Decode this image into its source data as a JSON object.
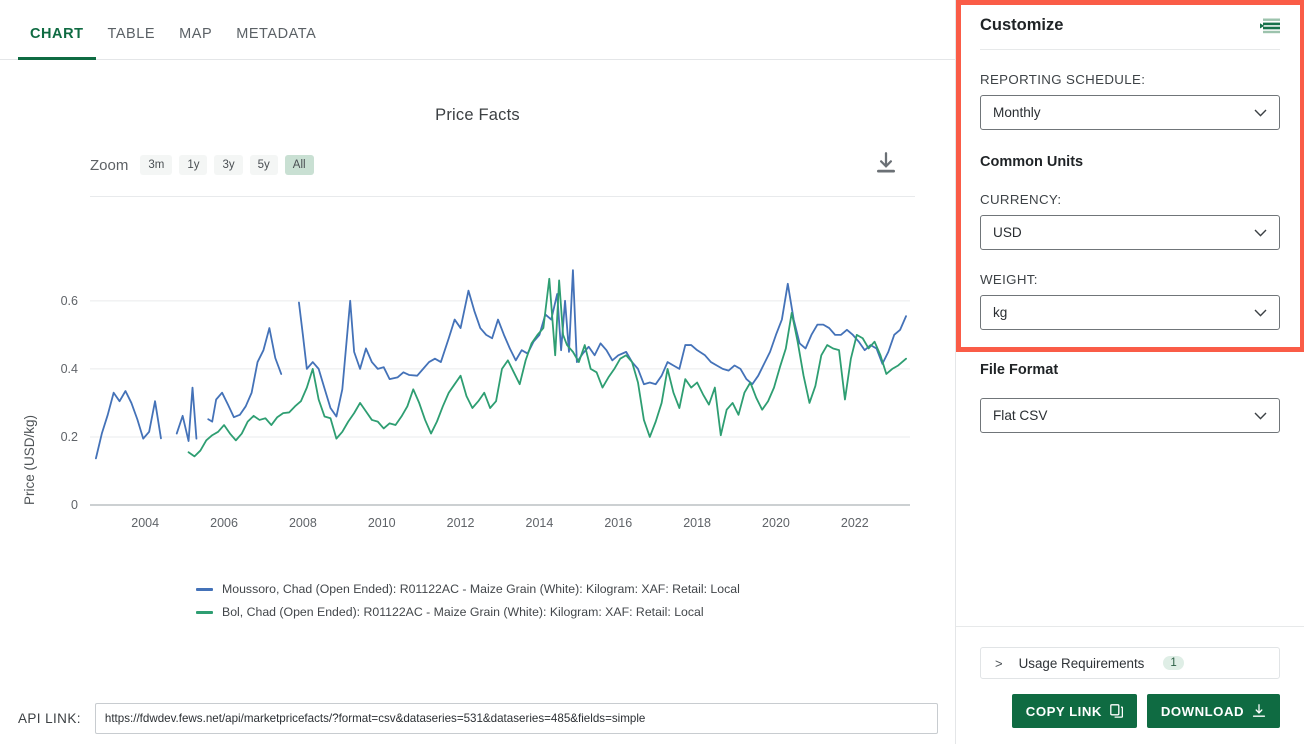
{
  "tabs": [
    {
      "label": "CHART",
      "active": true
    },
    {
      "label": "TABLE",
      "active": false
    },
    {
      "label": "MAP",
      "active": false
    },
    {
      "label": "METADATA",
      "active": false
    }
  ],
  "chart_header": {
    "title": "Price Facts",
    "zoom_label": "Zoom",
    "zoom_options": [
      "3m",
      "1y",
      "3y",
      "5y",
      "All"
    ],
    "zoom_selected": "All",
    "download_icon": "download-icon"
  },
  "chart_data": {
    "type": "line",
    "title": "Price Facts",
    "xlabel": "",
    "ylabel": "Price (USD/kg)",
    "xticks": [
      2004,
      2006,
      2008,
      2010,
      2012,
      2014,
      2016,
      2018,
      2020,
      2022
    ],
    "yticks": [
      0,
      0.2,
      0.4,
      0.6
    ],
    "ylim": [
      0,
      0.72
    ],
    "xlim": [
      2002.6,
      2023.4
    ],
    "grid": true,
    "legend_position": "bottom-left",
    "series": [
      {
        "name": "Moussoro, Chad (Open Ended): R01122AC - Maize Grain (White): Kilogram: XAF: Retail: Local",
        "color": "#4472b8",
        "points": [
          [
            2002.75,
            0.137
          ],
          [
            2002.9,
            0.21
          ],
          [
            2003.05,
            0.265
          ],
          [
            2003.2,
            0.33
          ],
          [
            2003.35,
            0.305
          ],
          [
            2003.5,
            0.335
          ],
          [
            2003.65,
            0.3
          ],
          [
            2003.8,
            0.252
          ],
          [
            2003.95,
            0.195
          ],
          [
            2004.1,
            0.215
          ],
          [
            2004.25,
            0.305
          ],
          [
            2004.4,
            0.196
          ],
          [
            2004.55,
            null
          ],
          [
            2004.8,
            0.21
          ],
          [
            2004.95,
            0.262
          ],
          [
            2005.1,
            0.188
          ],
          [
            2005.2,
            0.345
          ],
          [
            2005.3,
            0.195
          ],
          [
            2005.45,
            null
          ],
          [
            2005.6,
            0.252
          ],
          [
            2005.7,
            0.245
          ],
          [
            2005.8,
            0.31
          ],
          [
            2005.95,
            0.33
          ],
          [
            2006.1,
            0.295
          ],
          [
            2006.25,
            0.258
          ],
          [
            2006.4,
            0.265
          ],
          [
            2006.55,
            0.29
          ],
          [
            2006.7,
            0.33
          ],
          [
            2006.85,
            0.42
          ],
          [
            2007.0,
            0.455
          ],
          [
            2007.15,
            0.52
          ],
          [
            2007.3,
            0.432
          ],
          [
            2007.45,
            0.385
          ],
          [
            2007.6,
            null
          ],
          [
            2007.9,
            0.595
          ],
          [
            2008.0,
            0.5
          ],
          [
            2008.1,
            0.4
          ],
          [
            2008.25,
            0.42
          ],
          [
            2008.4,
            0.4
          ],
          [
            2008.55,
            0.342
          ],
          [
            2008.7,
            0.285
          ],
          [
            2008.85,
            0.26
          ],
          [
            2009.0,
            0.34
          ],
          [
            2009.2,
            0.6
          ],
          [
            2009.3,
            0.45
          ],
          [
            2009.45,
            0.4
          ],
          [
            2009.6,
            0.46
          ],
          [
            2009.75,
            0.42
          ],
          [
            2009.9,
            0.4
          ],
          [
            2010.05,
            0.405
          ],
          [
            2010.2,
            0.37
          ],
          [
            2010.4,
            0.375
          ],
          [
            2010.55,
            0.39
          ],
          [
            2010.7,
            0.382
          ],
          [
            2010.9,
            0.38
          ],
          [
            2011.05,
            0.4
          ],
          [
            2011.2,
            0.42
          ],
          [
            2011.35,
            0.43
          ],
          [
            2011.5,
            0.42
          ],
          [
            2011.7,
            0.49
          ],
          [
            2011.85,
            0.545
          ],
          [
            2012.0,
            0.52
          ],
          [
            2012.2,
            0.63
          ],
          [
            2012.35,
            0.57
          ],
          [
            2012.5,
            0.52
          ],
          [
            2012.65,
            0.5
          ],
          [
            2012.8,
            0.49
          ],
          [
            2012.95,
            0.545
          ],
          [
            2013.1,
            0.5
          ],
          [
            2013.25,
            0.46
          ],
          [
            2013.4,
            0.425
          ],
          [
            2013.55,
            0.455
          ],
          [
            2013.7,
            0.445
          ],
          [
            2013.85,
            0.48
          ],
          [
            2014.0,
            0.5
          ],
          [
            2014.15,
            0.56
          ],
          [
            2014.3,
            0.545
          ],
          [
            2014.45,
            0.62
          ],
          [
            2014.55,
            0.455
          ],
          [
            2014.65,
            0.6
          ],
          [
            2014.75,
            0.45
          ],
          [
            2014.85,
            0.69
          ],
          [
            2014.95,
            0.42
          ],
          [
            2015.1,
            0.445
          ],
          [
            2015.25,
            0.465
          ],
          [
            2015.4,
            0.44
          ],
          [
            2015.55,
            0.475
          ],
          [
            2015.7,
            0.455
          ],
          [
            2015.85,
            0.425
          ],
          [
            2016.0,
            0.44
          ],
          [
            2016.2,
            0.45
          ],
          [
            2016.35,
            0.42
          ],
          [
            2016.5,
            0.4
          ],
          [
            2016.65,
            0.355
          ],
          [
            2016.8,
            0.36
          ],
          [
            2016.95,
            0.355
          ],
          [
            2017.1,
            0.38
          ],
          [
            2017.25,
            0.42
          ],
          [
            2017.4,
            0.41
          ],
          [
            2017.55,
            0.4
          ],
          [
            2017.7,
            0.47
          ],
          [
            2017.85,
            0.47
          ],
          [
            2018.0,
            0.455
          ],
          [
            2018.2,
            0.44
          ],
          [
            2018.35,
            0.42
          ],
          [
            2018.5,
            0.41
          ],
          [
            2018.65,
            0.4
          ],
          [
            2018.8,
            0.395
          ],
          [
            2018.95,
            0.41
          ],
          [
            2019.1,
            0.4
          ],
          [
            2019.25,
            0.37
          ],
          [
            2019.4,
            0.355
          ],
          [
            2019.55,
            0.38
          ],
          [
            2019.7,
            0.415
          ],
          [
            2019.85,
            0.45
          ],
          [
            2020.0,
            0.5
          ],
          [
            2020.15,
            0.545
          ],
          [
            2020.3,
            0.65
          ],
          [
            2020.45,
            0.545
          ],
          [
            2020.6,
            0.475
          ],
          [
            2020.75,
            0.46
          ],
          [
            2020.9,
            0.5
          ],
          [
            2021.05,
            0.53
          ],
          [
            2021.2,
            0.53
          ],
          [
            2021.35,
            0.52
          ],
          [
            2021.5,
            0.5
          ],
          [
            2021.65,
            0.5
          ],
          [
            2021.8,
            0.515
          ],
          [
            2021.95,
            0.5
          ],
          [
            2022.1,
            0.48
          ],
          [
            2022.25,
            0.455
          ],
          [
            2022.4,
            0.47
          ],
          [
            2022.55,
            0.46
          ],
          [
            2022.7,
            0.415
          ],
          [
            2022.85,
            0.45
          ],
          [
            2023.0,
            0.5
          ],
          [
            2023.15,
            0.515
          ],
          [
            2023.3,
            0.555
          ]
        ]
      },
      {
        "name": "Bol, Chad (Open Ended): R01122AC - Maize Grain (White): Kilogram: XAF: Retail: Local",
        "color": "#2e9e72",
        "points": [
          [
            2005.1,
            0.155
          ],
          [
            2005.25,
            0.143
          ],
          [
            2005.4,
            0.16
          ],
          [
            2005.55,
            0.19
          ],
          [
            2005.7,
            0.205
          ],
          [
            2005.85,
            0.215
          ],
          [
            2006.0,
            0.235
          ],
          [
            2006.15,
            0.21
          ],
          [
            2006.3,
            0.19
          ],
          [
            2006.45,
            0.21
          ],
          [
            2006.6,
            0.245
          ],
          [
            2006.75,
            0.262
          ],
          [
            2006.9,
            0.25
          ],
          [
            2007.05,
            0.255
          ],
          [
            2007.2,
            0.235
          ],
          [
            2007.35,
            0.258
          ],
          [
            2007.5,
            0.27
          ],
          [
            2007.65,
            0.272
          ],
          [
            2007.8,
            0.29
          ],
          [
            2007.95,
            0.305
          ],
          [
            2008.1,
            0.345
          ],
          [
            2008.25,
            0.4
          ],
          [
            2008.4,
            0.31
          ],
          [
            2008.55,
            0.26
          ],
          [
            2008.7,
            0.255
          ],
          [
            2008.85,
            0.195
          ],
          [
            2009.0,
            0.215
          ],
          [
            2009.15,
            0.245
          ],
          [
            2009.3,
            0.27
          ],
          [
            2009.45,
            0.3
          ],
          [
            2009.6,
            0.275
          ],
          [
            2009.75,
            0.25
          ],
          [
            2009.9,
            0.245
          ],
          [
            2010.05,
            0.225
          ],
          [
            2010.2,
            0.24
          ],
          [
            2010.35,
            0.235
          ],
          [
            2010.5,
            0.26
          ],
          [
            2010.65,
            0.29
          ],
          [
            2010.8,
            0.34
          ],
          [
            2010.95,
            0.3
          ],
          [
            2011.1,
            0.25
          ],
          [
            2011.25,
            0.21
          ],
          [
            2011.4,
            0.245
          ],
          [
            2011.55,
            0.29
          ],
          [
            2011.7,
            0.33
          ],
          [
            2011.85,
            0.355
          ],
          [
            2012.0,
            0.38
          ],
          [
            2012.15,
            0.32
          ],
          [
            2012.3,
            0.285
          ],
          [
            2012.45,
            0.305
          ],
          [
            2012.6,
            0.33
          ],
          [
            2012.75,
            0.285
          ],
          [
            2012.9,
            0.305
          ],
          [
            2013.05,
            0.4
          ],
          [
            2013.2,
            0.425
          ],
          [
            2013.35,
            0.39
          ],
          [
            2013.5,
            0.355
          ],
          [
            2013.65,
            0.425
          ],
          [
            2013.8,
            0.475
          ],
          [
            2013.95,
            0.5
          ],
          [
            2014.1,
            0.52
          ],
          [
            2014.25,
            0.665
          ],
          [
            2014.4,
            0.44
          ],
          [
            2014.5,
            0.66
          ],
          [
            2014.6,
            0.5
          ],
          [
            2014.7,
            0.47
          ],
          [
            2014.85,
            0.45
          ],
          [
            2015.0,
            0.42
          ],
          [
            2015.15,
            0.47
          ],
          [
            2015.3,
            0.4
          ],
          [
            2015.45,
            0.39
          ],
          [
            2015.6,
            0.345
          ],
          [
            2015.75,
            0.375
          ],
          [
            2015.9,
            0.4
          ],
          [
            2016.05,
            0.43
          ],
          [
            2016.2,
            0.44
          ],
          [
            2016.35,
            0.42
          ],
          [
            2016.5,
            0.36
          ],
          [
            2016.65,
            0.25
          ],
          [
            2016.8,
            0.2
          ],
          [
            2016.95,
            0.245
          ],
          [
            2017.1,
            0.3
          ],
          [
            2017.25,
            0.4
          ],
          [
            2017.4,
            0.33
          ],
          [
            2017.55,
            0.285
          ],
          [
            2017.7,
            0.37
          ],
          [
            2017.85,
            0.345
          ],
          [
            2018.0,
            0.36
          ],
          [
            2018.15,
            0.325
          ],
          [
            2018.3,
            0.295
          ],
          [
            2018.45,
            0.345
          ],
          [
            2018.6,
            0.205
          ],
          [
            2018.75,
            0.28
          ],
          [
            2018.9,
            0.3
          ],
          [
            2019.05,
            0.265
          ],
          [
            2019.2,
            0.33
          ],
          [
            2019.35,
            0.36
          ],
          [
            2019.5,
            0.315
          ],
          [
            2019.65,
            0.28
          ],
          [
            2019.8,
            0.305
          ],
          [
            2019.95,
            0.345
          ],
          [
            2020.1,
            0.405
          ],
          [
            2020.25,
            0.46
          ],
          [
            2020.4,
            0.565
          ],
          [
            2020.55,
            0.48
          ],
          [
            2020.7,
            0.38
          ],
          [
            2020.85,
            0.3
          ],
          [
            2021.0,
            0.35
          ],
          [
            2021.15,
            0.44
          ],
          [
            2021.3,
            0.47
          ],
          [
            2021.45,
            0.46
          ],
          [
            2021.6,
            0.455
          ],
          [
            2021.75,
            0.31
          ],
          [
            2021.9,
            0.43
          ],
          [
            2022.05,
            0.5
          ],
          [
            2022.2,
            0.49
          ],
          [
            2022.35,
            0.46
          ],
          [
            2022.5,
            0.48
          ],
          [
            2022.65,
            0.44
          ],
          [
            2022.8,
            0.385
          ],
          [
            2022.95,
            0.4
          ],
          [
            2023.1,
            0.41
          ],
          [
            2023.3,
            0.43
          ]
        ]
      }
    ]
  },
  "api": {
    "label": "API LINK:",
    "value": "https://fdwdev.fews.net/api/marketpricefacts/?format=csv&dataseries=531&dataseries=485&fields=simple"
  },
  "panel": {
    "title": "Customize",
    "menu_icon": "list-settings-icon",
    "reporting_schedule": {
      "label": "REPORTING SCHEDULE:",
      "value": "Monthly"
    },
    "common_units": {
      "heading": "Common Units",
      "currency": {
        "label": "CURRENCY:",
        "value": "USD"
      },
      "weight": {
        "label": "WEIGHT:",
        "value": "kg"
      }
    },
    "file_format": {
      "heading": "File Format",
      "value": "Flat CSV"
    },
    "usage": {
      "label": "Usage Requirements",
      "count": "1",
      "caret": ">"
    },
    "buttons": {
      "copy_link": "COPY LINK",
      "download": "DOWNLOAD"
    },
    "highlight_color": "#fa5c47"
  }
}
